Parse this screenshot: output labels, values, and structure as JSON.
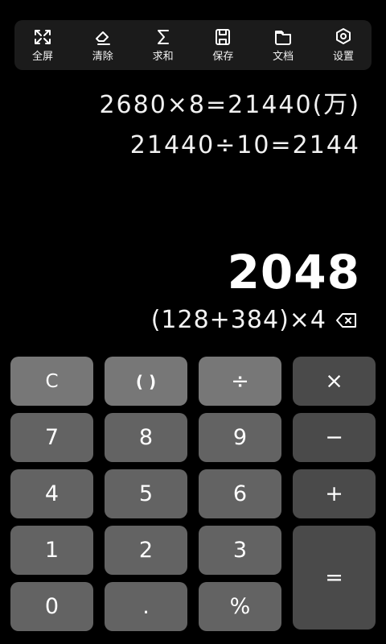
{
  "toolbar": {
    "items": [
      {
        "label": "全屏",
        "icon": "fullscreen-icon"
      },
      {
        "label": "清除",
        "icon": "eraser-icon"
      },
      {
        "label": "求和",
        "icon": "sigma-icon"
      },
      {
        "label": "保存",
        "icon": "save-icon"
      },
      {
        "label": "文档",
        "icon": "folder-icon"
      },
      {
        "label": "设置",
        "icon": "settings-icon"
      }
    ]
  },
  "history": [
    "2680×8=21440(万)",
    "21440÷10=2144"
  ],
  "display": {
    "result": "2048",
    "expression": "(128+384)×4",
    "backspace_icon": "backspace-icon"
  },
  "keys": {
    "row1": [
      "C",
      "( )",
      "÷",
      "×"
    ],
    "row2": [
      "7",
      "8",
      "9",
      "−"
    ],
    "row3": [
      "4",
      "5",
      "6",
      "+"
    ],
    "row4": [
      "1",
      "2",
      "3",
      "="
    ],
    "row5": [
      "0",
      ".",
      "%"
    ]
  },
  "colors": {
    "background": "#000000",
    "toolbar": "#1b1b1b",
    "key": "#636363",
    "key_light": "#777777",
    "key_operator": "#4a4a4a"
  }
}
